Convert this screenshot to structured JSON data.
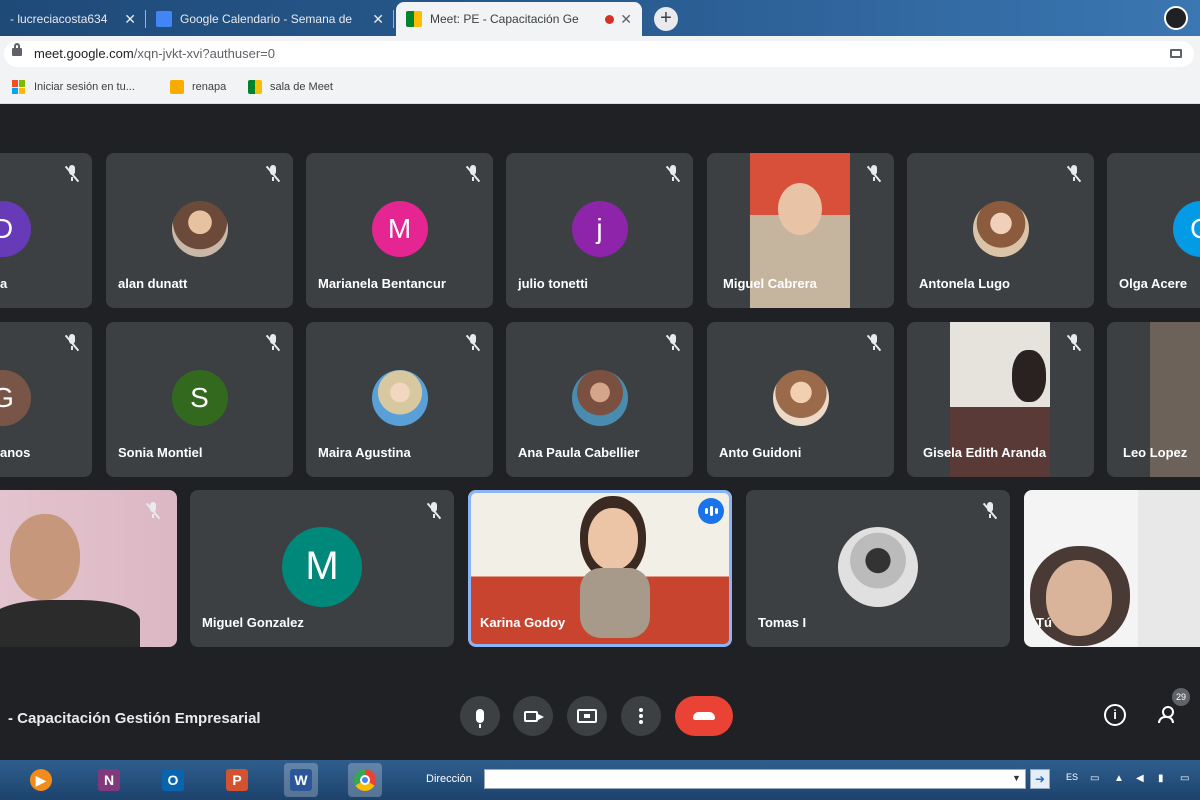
{
  "browser": {
    "tabs": [
      {
        "title": "- lucreciacosta634",
        "active": false
      },
      {
        "title": "Google Calendario - Semana de",
        "active": false
      },
      {
        "title": "Meet: PE - Capacitación Ge",
        "active": true,
        "recording": true
      }
    ],
    "url_host": "meet.google.com",
    "url_path": "/xqn-jvkt-xvi?authuser=0",
    "bookmarks": [
      "Iniciar sesión en tu...",
      "renapa",
      "sala de Meet"
    ]
  },
  "meet": {
    "row1": [
      {
        "name": "a",
        "initial": "D",
        "color": "#673ab7",
        "muted": true
      },
      {
        "name": "alan dunatt",
        "muted": true,
        "photo": "p1"
      },
      {
        "name": "Marianela Bentancur",
        "initial": "M",
        "color": "#e52592",
        "muted": true
      },
      {
        "name": "julio tonetti",
        "initial": "j",
        "color": "#8e24aa",
        "muted": true
      },
      {
        "name": "Miguel Cabrera",
        "muted": true,
        "video": true
      },
      {
        "name": "Antonela Lugo",
        "muted": true,
        "photo": "p2"
      },
      {
        "name": "Olga Acere",
        "initial": "O",
        "color": "#039be5",
        "muted": false
      }
    ],
    "row2": [
      {
        "name": "anos",
        "initial": "G",
        "color": "#795548",
        "muted": true
      },
      {
        "name": "Sonia Montiel",
        "initial": "S",
        "color": "#33691e",
        "muted": true
      },
      {
        "name": "Maira Agustina",
        "muted": true,
        "photo": "p3"
      },
      {
        "name": "Ana Paula Cabellier",
        "muted": true,
        "photo": "p4"
      },
      {
        "name": "Anto Guidoni",
        "muted": true,
        "photo": "p5"
      },
      {
        "name": "Gisela Edith Aranda",
        "muted": true,
        "video": true
      },
      {
        "name": "Leo Lopez",
        "muted": false,
        "video": true
      }
    ],
    "row3": [
      {
        "name": "",
        "muted": true,
        "video": true
      },
      {
        "name": "Miguel Gonzalez",
        "initial": "M",
        "color": "#00897b",
        "muted": true
      },
      {
        "name": "Karina Godoy",
        "muted": false,
        "video": true,
        "speaking": true
      },
      {
        "name": "Tomas I",
        "muted": true,
        "photo": "p6"
      },
      {
        "name": "Tú",
        "muted": false,
        "video": true
      }
    ],
    "meeting_title": "- Capacitación Gestión Empresarial",
    "participants_count": "29"
  },
  "taskbar": {
    "address_label": "Dirección",
    "address_value": "",
    "language": "ES"
  }
}
